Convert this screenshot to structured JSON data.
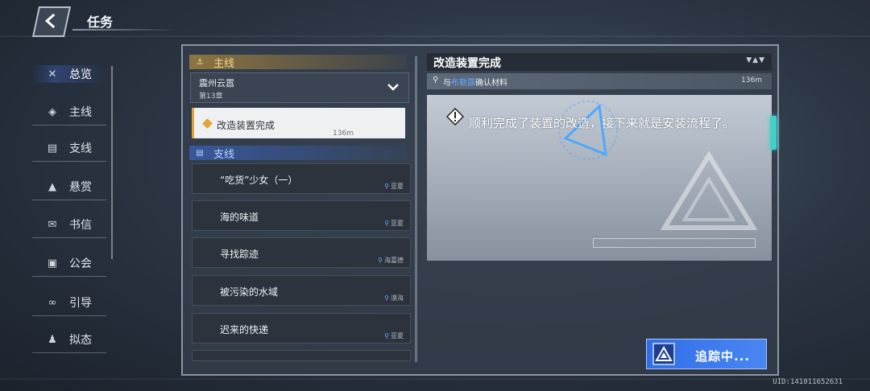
{
  "header": {
    "title": "任务"
  },
  "nav": [
    {
      "label": "总览",
      "icon": "crossed-tools-icon",
      "active": true
    },
    {
      "label": "主线",
      "icon": "emblem-icon"
    },
    {
      "label": "支线",
      "icon": "scroll-icon"
    },
    {
      "label": "悬赏",
      "icon": "mountain-icon"
    },
    {
      "label": "书信",
      "icon": "envelope-icon"
    },
    {
      "label": "公会",
      "icon": "guild-icon"
    },
    {
      "label": "引导",
      "icon": "loop-icon"
    },
    {
      "label": "拟态",
      "icon": "figure-icon"
    }
  ],
  "main_section": {
    "label": "主线",
    "region": "震州云嚣",
    "chapter": "第13章",
    "active_quest": {
      "name": "改造装置完成",
      "distance": "136m"
    }
  },
  "side_section": {
    "label": "支线",
    "quests": [
      {
        "name": "“吃货”少女（一）",
        "location": "亚夏"
      },
      {
        "name": "海的味道",
        "location": "亚夏"
      },
      {
        "name": "寻找踪迹",
        "location": "海嘉德"
      },
      {
        "name": "被污染的水域",
        "location": "漠海"
      },
      {
        "name": "迟来的快递",
        "location": "亚夏"
      }
    ]
  },
  "detail": {
    "title": "改造装置完成",
    "arrows": "▼▲▼",
    "objective_prefix": "与",
    "objective_npc": "布勒露",
    "objective_suffix": "确认材料",
    "objective_distance": "136m",
    "description": "顺利完成了装置的改造，接下来就是安装流程了。"
  },
  "track_button": {
    "label": "追踪中..."
  },
  "uid": "UID:141011652631",
  "colors": {
    "accent_blue": "#3a78ec",
    "main_gold": "#e0a33a",
    "side_tab": "#3fd0c8"
  }
}
